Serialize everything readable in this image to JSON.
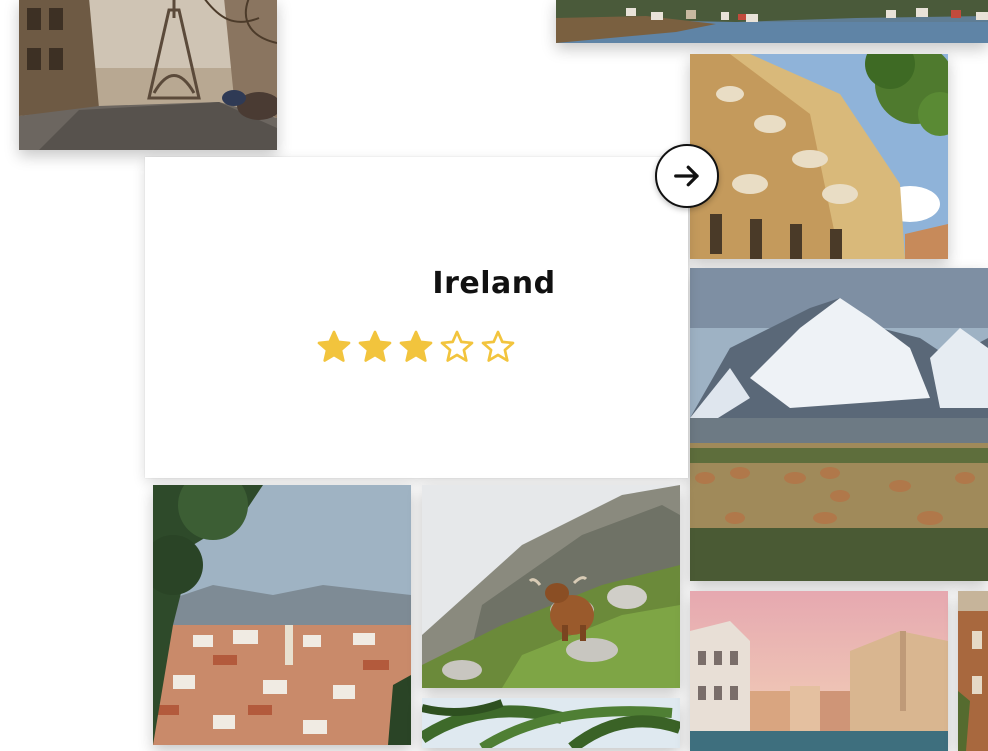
{
  "destination": {
    "name": "Ireland",
    "rating": 3,
    "rating_max": 5
  },
  "rating_color": "#f2c43d",
  "next_button": {
    "icon": "arrow-right-icon"
  },
  "tiles": [
    {
      "name": "photo-paris-eiffel-street"
    },
    {
      "name": "photo-coastal-village"
    },
    {
      "name": "photo-casa-batllo"
    },
    {
      "name": "photo-patagonia-guanacos"
    },
    {
      "name": "photo-split-city"
    },
    {
      "name": "photo-highland-cow"
    },
    {
      "name": "photo-palm-leaves"
    },
    {
      "name": "photo-venice-canal"
    },
    {
      "name": "photo-brick-building"
    }
  ]
}
